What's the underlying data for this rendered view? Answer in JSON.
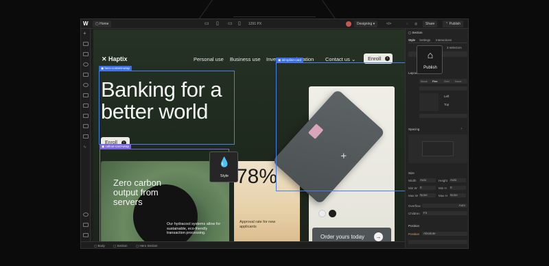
{
  "toolbar": {
    "home": "Home",
    "resolution": "1291 PX",
    "mode": "Designing",
    "share": "Share",
    "publish": "Publish"
  },
  "site": {
    "logo": "Haptix",
    "nav": [
      "Personal use",
      "Business use",
      "Investment",
      "Education",
      "Contact us"
    ],
    "enroll_nav": "Enroll",
    "hero_title_line1": "Banking for a",
    "hero_title_line2": "better world",
    "hero_enroll": "Enroll",
    "callout_title_line1": "Zero carbon",
    "callout_title_line2": "output from",
    "callout_title_line3": "servers",
    "callout_body": "Our hydracool systems allow for sustainable, eco-friendly transaction processing.",
    "stat_value": "78%",
    "stat_caption": "Approval rate for new applicants",
    "order_label": "Order yours today"
  },
  "selection_tags": {
    "hero": "hero-content-wrap",
    "spline": "3d-spline-card",
    "callout": "callout-card-wrap"
  },
  "floating": {
    "style": "Style",
    "publish": "Publish"
  },
  "panel": {
    "section_title": "Section",
    "tabs": [
      "Style",
      "Settings",
      "Interactions"
    ],
    "selector_note": "3 selectors",
    "layout_section": "Layout",
    "display_options": [
      "Block",
      "Flex",
      "Grid",
      "None"
    ],
    "spacing": "Spacing",
    "size": "Size",
    "size_labels": [
      "Width",
      "Height",
      "Min W",
      "Min H",
      "Max W",
      "Max H"
    ],
    "size_values": [
      "Auto",
      "Auto",
      "0",
      "0",
      "None",
      "None"
    ],
    "overflow": "Overflow",
    "overflow_value": "Auto",
    "children": "Children",
    "children_value": "Fit",
    "position": "Position",
    "position_label": "Position",
    "position_value": "Absolute",
    "align_left": "Left",
    "align_top": "Top"
  },
  "breadcrumbs": [
    "Body",
    "Section",
    "Hero Section"
  ],
  "colors": {
    "accent_blue": "#3a6de8",
    "callout_purple": "#7b66e0",
    "canvas_green": "#253224",
    "card_dark": "#4f5556"
  }
}
